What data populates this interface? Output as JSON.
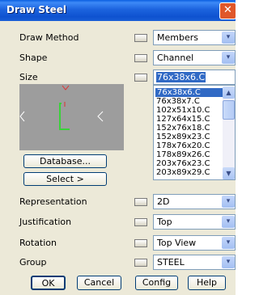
{
  "window": {
    "title": "Draw Steel",
    "close_glyph": "✕"
  },
  "rows": [
    {
      "label": "Draw Method",
      "value": "Members"
    },
    {
      "label": "Shape",
      "value": "Channel"
    },
    {
      "label": "Size",
      "value": "76x38x6.C"
    },
    {
      "label": "Representation",
      "value": "2D"
    },
    {
      "label": "Justification",
      "value": "Top"
    },
    {
      "label": "Rotation",
      "value": "Top View"
    },
    {
      "label": "Group",
      "value": "STEEL"
    }
  ],
  "size_list": [
    "76x38x6.C",
    "76x38x7.C",
    "102x51x10.C",
    "127x64x15.C",
    "152x76x18.C",
    "152x89x23.C",
    "178x76x20.C",
    "178x89x26.C",
    "203x76x23.C",
    "203x89x29.C"
  ],
  "size_list_selected_index": 0,
  "buttons": {
    "database": "Database...",
    "select": "Select >",
    "ok": "OK",
    "cancel": "Cancel",
    "config": "Config",
    "help": "Help"
  },
  "icons": {
    "dropdown": "▾",
    "scroll_up": "▲",
    "scroll_down": "▼",
    "preview_arrow_left": "‹",
    "preview_arrow_right": "›"
  },
  "colors": {
    "title_bar": "#0a5ee0",
    "selection": "#316ac5",
    "preview_bg": "#9d9d9d",
    "shape_green": "#3ad13a",
    "marker_red": "#e03030"
  }
}
